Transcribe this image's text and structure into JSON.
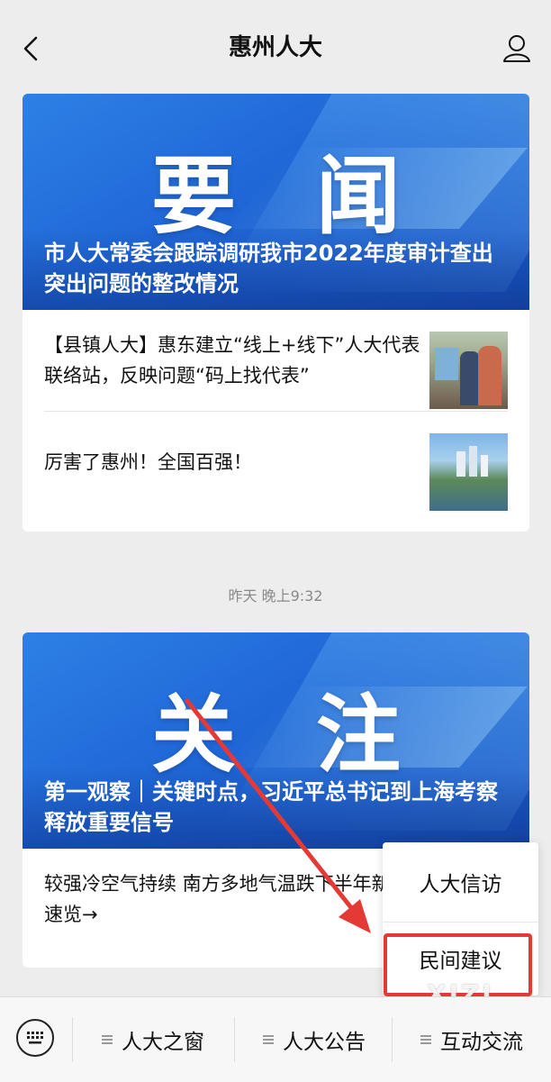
{
  "header": {
    "title": "惠州人大",
    "back_icon": "chevron-left-icon",
    "profile_icon": "user-icon"
  },
  "articles_top": {
    "cover_word": "要 闻",
    "headline": "市人大常委会跟踪调研我市2022年度审计查出突出问题的整改情况",
    "items": [
      {
        "text": "【县镇人大】惠东建立“线上+线下”人大代表联络站，反映问题“码上找代表”"
      },
      {
        "text": "厉害了惠州！全国百强！"
      }
    ]
  },
  "timestamp": "昨天 晚上9:32",
  "articles_bottom": {
    "cover_word": "关 注",
    "headline": "第一观察｜关键时点，习近平总书记到上海考察释放重要信号",
    "items": [
      {
        "text": "较强冷空气持续 南方多地气温跌下半年新低 全国天气速览→"
      }
    ]
  },
  "popup_menu": {
    "items": [
      "人大信访",
      "民间建议"
    ]
  },
  "bottom_menu": {
    "keyboard_icon": "keyboard-icon",
    "items": [
      "人大之窗",
      "人大公告",
      "互动交流"
    ]
  },
  "watermark": "XIZI",
  "colors": {
    "accent_red": "#e53935",
    "cover_blue": "#1f66d6"
  }
}
